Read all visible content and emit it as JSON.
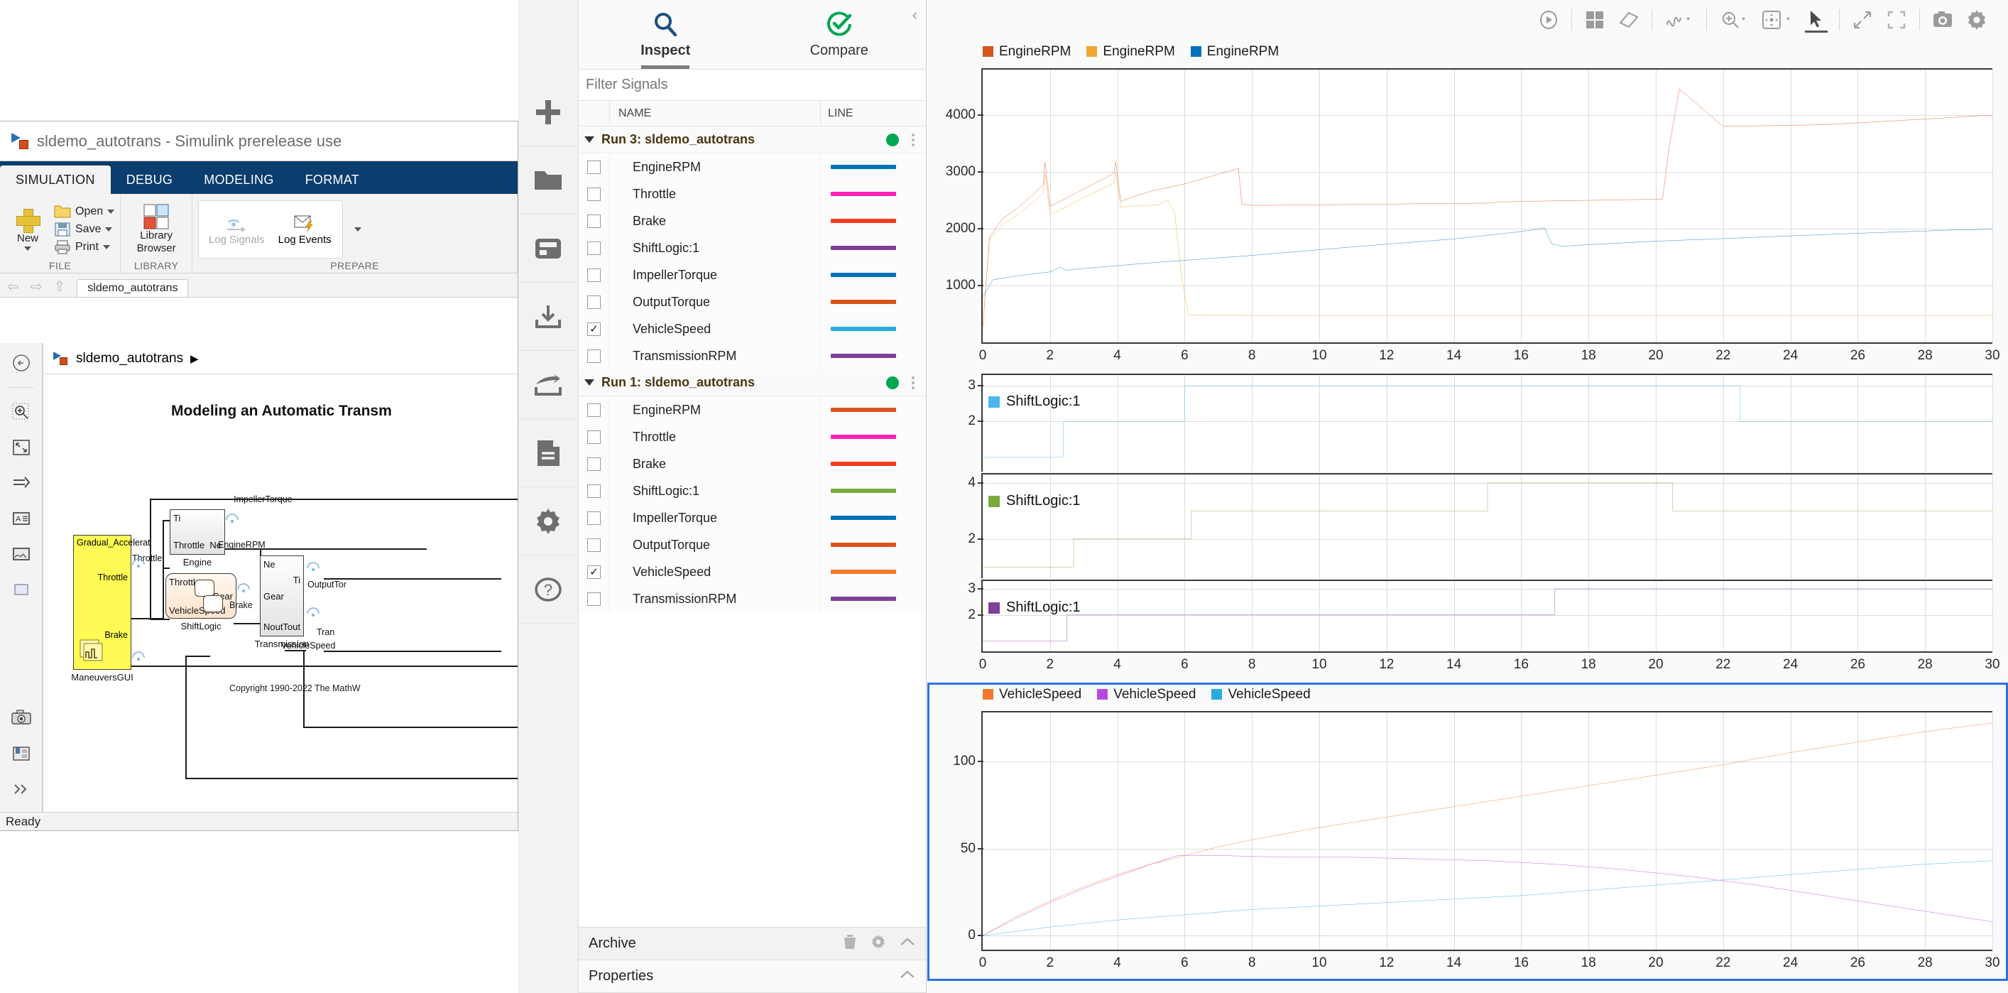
{
  "simulink": {
    "window_title": "sldemo_autotrans - Simulink prerelease use",
    "ribbon_tabs": [
      {
        "label": "SIMULATION",
        "active": true
      },
      {
        "label": "DEBUG",
        "active": false
      },
      {
        "label": "MODELING",
        "active": false
      },
      {
        "label": "FORMAT",
        "active": false
      }
    ],
    "groups": [
      {
        "label": "FILE",
        "new_label": "New",
        "items": [
          "Open",
          "Save",
          "Print"
        ]
      },
      {
        "label": "LIBRARY",
        "items": [
          "Library Browser"
        ]
      },
      {
        "label": "PREPARE",
        "items": [
          "Log Signals",
          "Log Events"
        ]
      }
    ],
    "file_group_label": "FILE",
    "library_group_label": "LIBRARY",
    "prepare_group_label": "PREPARE",
    "new_label": "New",
    "open_label": "Open",
    "save_label": "Save",
    "print_label": "Print",
    "library_browser_label": "Library Browser",
    "log_signals_label": "Log Signals",
    "log_events_label": "Log Events",
    "model_tab_label": "sldemo_autotrans",
    "breadcrumb": "sldemo_autotrans",
    "model_title": "Modeling an Automatic Transm",
    "copyright": "Copyright 1990-2022 The MathW",
    "status": "Ready",
    "blocks": {
      "engine": {
        "name": "Engine",
        "in1": "Ti",
        "in2": "Throttle",
        "out1": "Ne"
      },
      "shiftlogic": {
        "name": "ShiftLogic",
        "in1": "Throttle",
        "in2": "VehicleSpeed",
        "out1": "Gear"
      },
      "transmission": {
        "name": "Transmission",
        "in1": "Ne",
        "in2": "Gear",
        "in3": "Nout",
        "out1": "Ti",
        "out2": "Tout"
      },
      "maneuvers": {
        "name": "ManeuversGUI",
        "title": "Gradual_Accelerat",
        "out1": "Throttle",
        "out2": "Brake"
      }
    },
    "signal_labels": [
      "ImpellerTorque",
      "EngineRPM",
      "Throttle",
      "Brake",
      "OutputTor",
      "Tran",
      "VehicleSpeed"
    ]
  },
  "sdi": {
    "tabs": [
      {
        "label": "Inspect",
        "icon": "search-icon",
        "active": true
      },
      {
        "label": "Compare",
        "icon": "check-circle-icon",
        "active": false
      }
    ],
    "filter_placeholder": "Filter Signals",
    "columns": {
      "check": "",
      "name": "NAME",
      "line": "LINE"
    },
    "rail_icons": [
      "add-icon",
      "folder-open-icon",
      "save-icon",
      "import-icon",
      "export-icon",
      "report-icon",
      "settings-icon",
      "help-icon"
    ],
    "runs": [
      {
        "title": "Run 3: sldemo_autotrans",
        "expanded": true,
        "status_color": "#00a650",
        "signals": [
          {
            "name": "EngineRPM",
            "checked": false,
            "color": "#0072bd"
          },
          {
            "name": "Throttle",
            "checked": false,
            "color": "#ff22b0"
          },
          {
            "name": "Brake",
            "checked": false,
            "color": "#f43a1e"
          },
          {
            "name": "ShiftLogic:1",
            "checked": false,
            "color": "#7e3f98"
          },
          {
            "name": "ImpellerTorque",
            "checked": false,
            "color": "#0072bd"
          },
          {
            "name": "OutputTorque",
            "checked": false,
            "color": "#d95319"
          },
          {
            "name": "VehicleSpeed",
            "checked": true,
            "color": "#29abe2"
          },
          {
            "name": "TransmissionRPM",
            "checked": false,
            "color": "#7e3f98"
          }
        ]
      },
      {
        "title": "Run 1: sldemo_autotrans",
        "expanded": true,
        "status_color": "#00a650",
        "signals": [
          {
            "name": "EngineRPM",
            "checked": false,
            "color": "#d9541f"
          },
          {
            "name": "Throttle",
            "checked": false,
            "color": "#ff22b0"
          },
          {
            "name": "Brake",
            "checked": false,
            "color": "#f43a1e"
          },
          {
            "name": "ShiftLogic:1",
            "checked": false,
            "color": "#7aab3a"
          },
          {
            "name": "ImpellerTorque",
            "checked": false,
            "color": "#0072bd"
          },
          {
            "name": "OutputTorque",
            "checked": false,
            "color": "#d95319"
          },
          {
            "name": "VehicleSpeed",
            "checked": true,
            "color": "#f4772e"
          },
          {
            "name": "TransmissionRPM",
            "checked": false,
            "color": "#7e3f98"
          }
        ]
      }
    ],
    "archive": {
      "label": "Archive",
      "icons": [
        "trash-icon",
        "gear-icon",
        "chevron-up-icon"
      ]
    },
    "properties": {
      "label": "Properties",
      "icons": [
        "chevron-up-icon"
      ]
    }
  },
  "plot_toolbar": {
    "buttons": [
      {
        "name": "run-icon",
        "selected": false
      },
      {
        "name": "layout-grid-icon",
        "selected": false
      },
      {
        "name": "eraser-icon",
        "selected": false
      },
      {
        "name": "signal-style-icon",
        "selected": false
      },
      {
        "name": "zoom-in-icon",
        "selected": false
      },
      {
        "name": "pan-icon",
        "selected": false
      },
      {
        "name": "cursor-arrow-icon",
        "selected": true
      },
      {
        "name": "expand-diagonal-icon",
        "selected": false
      },
      {
        "name": "fit-to-view-icon",
        "selected": false
      },
      {
        "name": "snapshot-icon",
        "selected": false
      },
      {
        "name": "settings-gear-icon",
        "selected": false
      }
    ]
  },
  "chart_data": [
    {
      "type": "line",
      "title": "EngineRPM",
      "xlabel": "",
      "ylabel": "",
      "xlim": [
        0,
        30
      ],
      "ylim": [
        0,
        4800
      ],
      "xticks": [
        0,
        2,
        4,
        6,
        8,
        10,
        12,
        14,
        16,
        18,
        20,
        22,
        24,
        26,
        28,
        30
      ],
      "yticks": [
        1000,
        2000,
        3000,
        4000
      ],
      "grid": true,
      "legend": [
        "EngineRPM",
        "EngineRPM",
        "EngineRPM"
      ],
      "legend_position": "top-left",
      "series": [
        {
          "name": "EngineRPM",
          "color": "#d9541f",
          "x": [
            0,
            0.2,
            0.6,
            1.0,
            1.5,
            1.8,
            1.85,
            2.0,
            2.2,
            3.0,
            3.6,
            3.9,
            3.95,
            4.1,
            4.4,
            5.0,
            6.0,
            7.0,
            7.6,
            7.7,
            8.0,
            10.0,
            13.0,
            15.0,
            15.1,
            16.0,
            18.0,
            20.2,
            20.4,
            20.7,
            22.0,
            25.0,
            28.0,
            30.0
          ],
          "y": [
            250,
            1850,
            2180,
            2350,
            2600,
            2780,
            3170,
            2400,
            2450,
            2700,
            2880,
            2980,
            3180,
            2480,
            2550,
            2660,
            2790,
            2960,
            3060,
            2430,
            2410,
            2420,
            2440,
            2450,
            2460,
            2480,
            2500,
            2520,
            3450,
            4460,
            3800,
            3830,
            3930,
            4000
          ]
        },
        {
          "name": "EngineRPM",
          "color": "#f0a830",
          "x": [
            0,
            0.2,
            0.6,
            1.0,
            1.5,
            1.8,
            1.85,
            2.0,
            2.2,
            3.0,
            3.6,
            3.9,
            3.95,
            4.1,
            4.5,
            5.2,
            5.5,
            5.7,
            5.9,
            6.1,
            10.0,
            20.0,
            30.0
          ],
          "y": [
            250,
            1800,
            2080,
            2230,
            2470,
            2620,
            2960,
            2250,
            2300,
            2550,
            2720,
            2800,
            2990,
            2380,
            2400,
            2420,
            2500,
            2300,
            1200,
            480,
            470,
            470,
            470
          ]
        },
        {
          "name": "EngineRPM",
          "color": "#0072bd",
          "x": [
            0,
            0.3,
            1.0,
            2.0,
            2.3,
            2.5,
            3.0,
            5.0,
            8.0,
            11.0,
            14.0,
            16.0,
            16.7,
            16.9,
            17.2,
            18.0,
            20.0,
            23.0,
            26.0,
            29.0,
            30.0
          ],
          "y": [
            800,
            1100,
            1170,
            1240,
            1320,
            1270,
            1300,
            1400,
            1530,
            1680,
            1820,
            1950,
            2010,
            1740,
            1690,
            1720,
            1780,
            1850,
            1920,
            1980,
            1990
          ]
        }
      ]
    },
    {
      "type": "line",
      "title": "ShiftLogic:1",
      "xlim": [
        0,
        30
      ],
      "ylim": [
        0.6,
        3.3
      ],
      "yticks": [
        2,
        3
      ],
      "grid": true,
      "legend": [
        "ShiftLogic:1"
      ],
      "step": true,
      "series": [
        {
          "name": "ShiftLogic:1",
          "color": "#4ab8ef",
          "x": [
            0,
            2.4,
            2.4,
            6.0,
            6.0,
            22.5,
            22.5,
            30
          ],
          "y": [
            1,
            1,
            2,
            2,
            3,
            3,
            2,
            2
          ]
        }
      ]
    },
    {
      "type": "line",
      "title": "ShiftLogic:1",
      "xlim": [
        0,
        30
      ],
      "ylim": [
        0.6,
        4.3
      ],
      "yticks": [
        2,
        4
      ],
      "grid": true,
      "legend": [
        "ShiftLogic:1"
      ],
      "step": true,
      "series": [
        {
          "name": "ShiftLogic:1",
          "color": "#7aab3a",
          "x": [
            0,
            2.7,
            2.7,
            6.2,
            6.2,
            15.0,
            15.0,
            20.5,
            20.5,
            30
          ],
          "y": [
            1,
            1,
            2,
            2,
            3,
            3,
            4,
            4,
            3,
            3
          ]
        }
      ]
    },
    {
      "type": "line",
      "title": "ShiftLogic:1",
      "xlim": [
        0,
        30
      ],
      "ylim": [
        0.6,
        3.3
      ],
      "yticks": [
        2,
        3
      ],
      "xticks": [
        0,
        2,
        4,
        6,
        8,
        10,
        12,
        14,
        16,
        18,
        20,
        22,
        24,
        26,
        28,
        30
      ],
      "grid": true,
      "legend": [
        "ShiftLogic:1"
      ],
      "step": true,
      "series": [
        {
          "name": "ShiftLogic:1",
          "color": "#7e3f98",
          "x": [
            0,
            2.5,
            2.5,
            17.0,
            17.0,
            30
          ],
          "y": [
            1,
            1,
            2,
            2,
            3,
            3
          ]
        }
      ]
    },
    {
      "type": "line",
      "title": "VehicleSpeed",
      "xlim": [
        0,
        30
      ],
      "ylim": [
        -8,
        128
      ],
      "yticks": [
        0,
        50,
        100
      ],
      "xticks": [
        0,
        2,
        4,
        6,
        8,
        10,
        12,
        14,
        16,
        18,
        20,
        22,
        24,
        26,
        28,
        30
      ],
      "grid": true,
      "legend": [
        "VehicleSpeed",
        "VehicleSpeed",
        "VehicleSpeed"
      ],
      "selected": true,
      "series": [
        {
          "name": "VehicleSpeed",
          "color": "#f4772e",
          "x": [
            0,
            1,
            2,
            3,
            4,
            5,
            6,
            7,
            8,
            10,
            12,
            14,
            16,
            18,
            20,
            22,
            24,
            26,
            28,
            30
          ],
          "y": [
            0,
            11,
            20,
            28,
            35,
            41,
            46,
            51,
            55,
            62,
            68,
            74,
            80,
            86,
            92,
            98,
            105,
            111,
            117,
            122
          ]
        },
        {
          "name": "VehicleSpeed",
          "color": "#b64ae0",
          "x": [
            0,
            1,
            2,
            3,
            4,
            5,
            5.8,
            7,
            9,
            11,
            13,
            15,
            17,
            19,
            21,
            23,
            25,
            27,
            29,
            30
          ],
          "y": [
            0,
            10,
            19,
            27,
            34,
            41,
            46,
            46,
            45,
            45,
            44,
            43,
            41,
            38,
            34,
            29,
            23,
            17,
            11,
            8
          ]
        },
        {
          "name": "VehicleSpeed",
          "color": "#29abe2",
          "x": [
            0,
            2,
            4,
            6,
            8,
            10,
            12,
            14,
            16,
            18,
            20,
            22,
            24,
            26,
            28,
            30
          ],
          "y": [
            0,
            5,
            9,
            12,
            15,
            17,
            19,
            21,
            23,
            26,
            29,
            32,
            35,
            38,
            41,
            43
          ]
        }
      ]
    }
  ]
}
